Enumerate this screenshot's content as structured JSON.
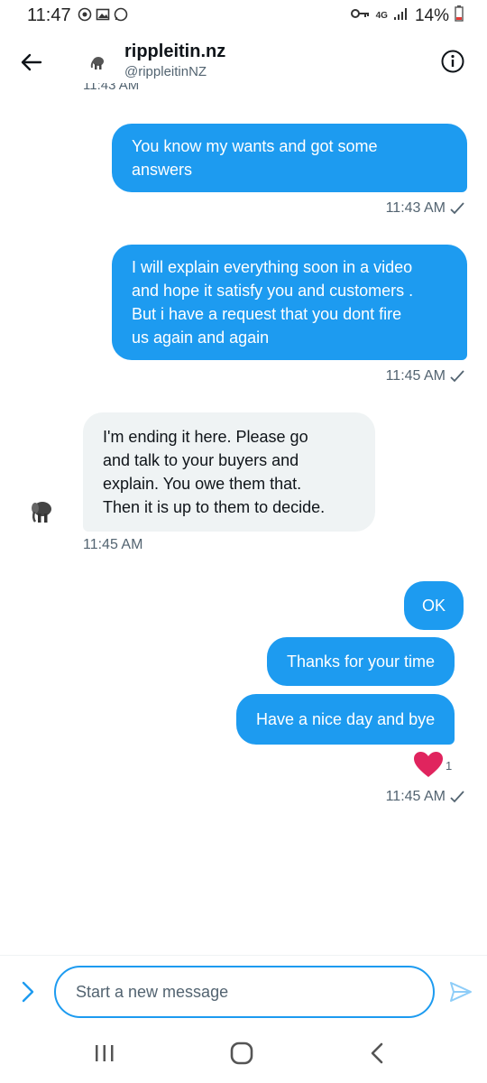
{
  "status_bar": {
    "time": "11:47",
    "network": "4G",
    "battery": "14%"
  },
  "header": {
    "name": "rippleitin.nz",
    "handle": "@rippleitinNZ",
    "cut_timestamp": "11:43 AM"
  },
  "messages": [
    {
      "direction": "outgoing",
      "lines": [
        "You know my wants and got some",
        "answers"
      ],
      "time": "11:43 AM",
      "read": true
    },
    {
      "direction": "outgoing",
      "lines": [
        "I will explain everything soon in a video",
        "and hope it satisfy you and customers .",
        "But i have a request that you dont fire",
        "us again and again"
      ],
      "time": "11:45 AM",
      "read": true
    },
    {
      "direction": "incoming",
      "lines": [
        "I'm ending it here. Please go",
        "and talk to your buyers and",
        "explain. You owe them that.",
        "Then it is up to them to decide."
      ],
      "time": "11:45 AM"
    },
    {
      "direction": "outgoing",
      "lines": [
        "OK"
      ]
    },
    {
      "direction": "outgoing",
      "lines": [
        "Thanks for your time"
      ]
    },
    {
      "direction": "outgoing",
      "lines": [
        "Have a nice day and bye"
      ],
      "time": "11:45 AM",
      "read": true,
      "reaction": {
        "icon": "heart-icon",
        "count": "1"
      }
    }
  ],
  "composer": {
    "placeholder": "Start a new message"
  },
  "colors": {
    "accent": "#1d9bf0",
    "incoming_bubble": "#eff3f4",
    "secondary_text": "#536471",
    "reaction_heart": "#e0245e"
  }
}
